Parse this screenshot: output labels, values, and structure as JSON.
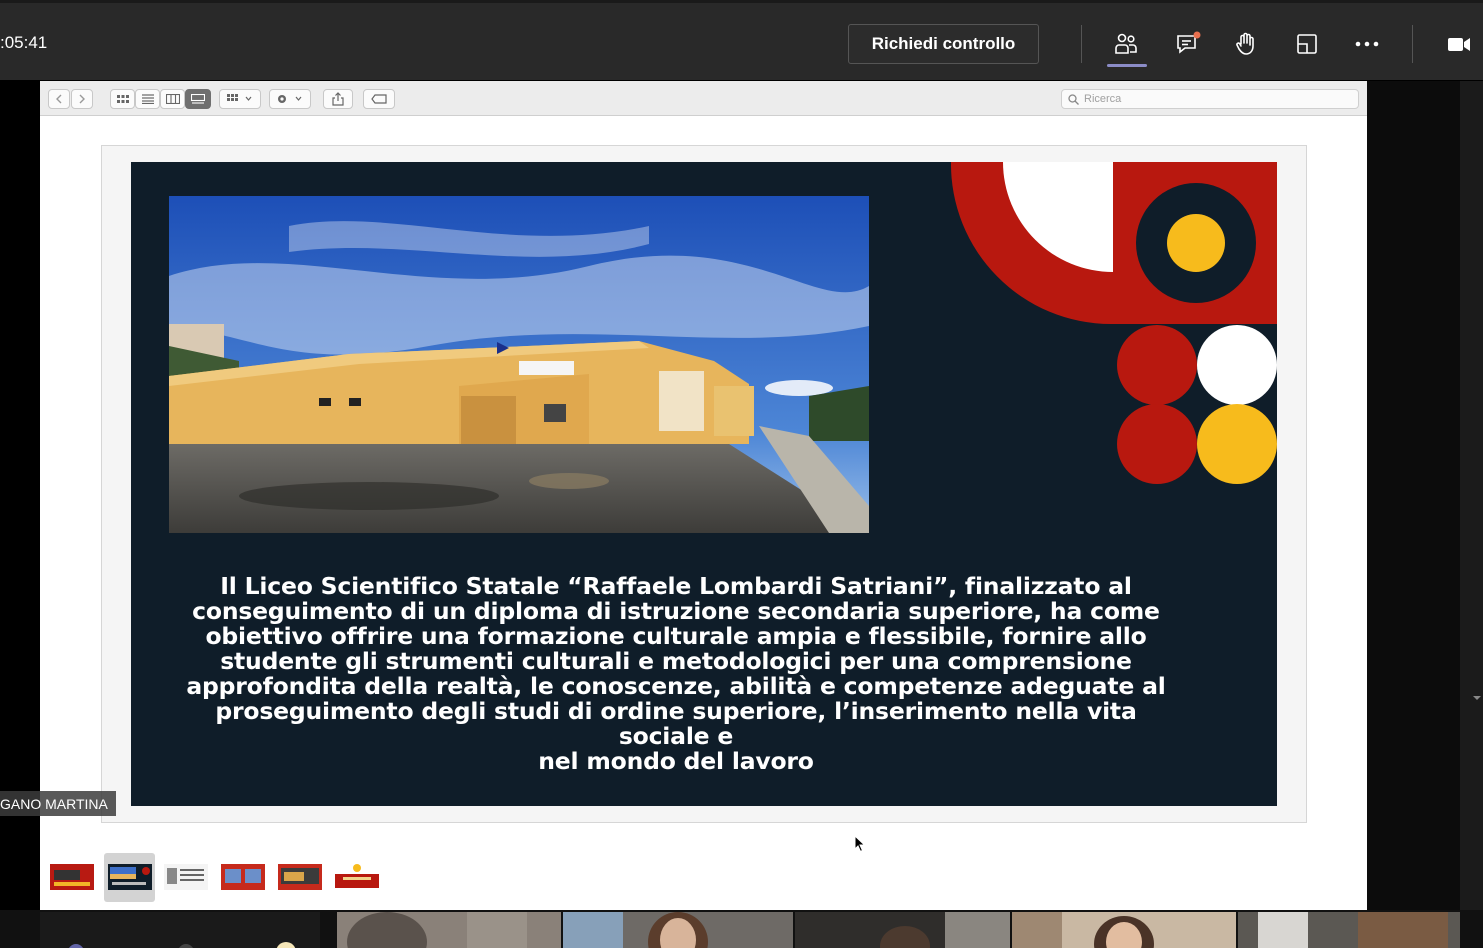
{
  "meeting": {
    "timer": ":05:41",
    "request_control_label": "Richiedi controllo",
    "toolbar_icons": [
      "participants-icon",
      "chat-icon",
      "raise-hand-icon",
      "share-tray-icon",
      "more-icon",
      "camera-icon"
    ],
    "accent_color": "#8b8cc7",
    "notification_color": "#e9704f"
  },
  "finder": {
    "search_placeholder": "Ricerca",
    "view_modes": [
      "icon-view",
      "list-view",
      "column-view",
      "gallery-view"
    ],
    "active_view": "gallery-view"
  },
  "slide": {
    "text": "Il  Liceo Scientifico Statale  “Raffaele Lombardi Satriani”,  finalizzato  al conseguimento di un diploma di istruzione secondaria superiore,   ha  come obiettivo  offrire una formazione culturale ampia e  flessibile, fornire allo studente gli strumenti culturali e metodologici per una comprensione approfondita della realtà, le conoscenze, abilità e competenze adeguate al proseguimento degli studi di ordine superiore, l’inserimento nella vita sociale e nel mondo del lavoro",
    "lines": [
      "Il  Liceo Scientifico Statale  “Raffaele Lombardi Satriani”,  finalizzato  al",
      "conseguimento di un diploma di istruzione secondaria superiore,   ha  come",
      "obiettivo  offrire una formazione culturale ampia e  flessibile, fornire allo",
      "studente gli strumenti culturali e metodologici per una comprensione",
      "approfondita della realtà, le conoscenze, abilità e competenze adeguate al",
      "proseguimento degli studi di ordine superiore, l’inserimento nella vita sociale e",
      "nel mondo del lavoro"
    ],
    "background_color": "#0f1d29",
    "red": "#b8180f",
    "yellow": "#f7bb1c"
  },
  "thumbnails_count": 6,
  "selected_thumbnail": 2,
  "presenter_name": "GANO MARTINA"
}
